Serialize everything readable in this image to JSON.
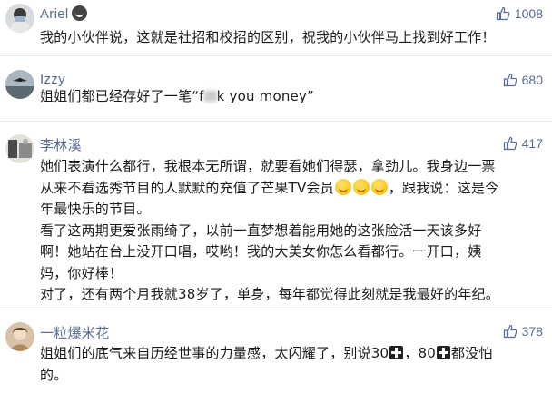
{
  "comments": [
    {
      "username": "Ariel",
      "likes": "1008",
      "lines": [
        "我的小伙伴说，这就是社招和校招的区别，祝我的小伙伴马上找到好工作！"
      ]
    },
    {
      "username": "Izzy",
      "likes": "680",
      "text_before": "姐姐们都已经存好了一笔“f",
      "text_after": "k you money”"
    },
    {
      "username": "李林溪",
      "likes": "417",
      "lines": [
        "她们表演什么都行，我根本无所谓，就要看她们得瑟，拿劲儿。我身边一票",
        "从来不看选秀节目的人默默的充值了芒果TV会员",
        "，跟我说：这是今",
        "年最快乐的节目。",
        "看了这两期更爱张雨绮了，以前一直梦想着能用她的这张脸活一天该多好",
        "啊！她站在台上没开口唱，哎哟！我的大美女你怎么看都行。一开口，姨",
        "妈，你好棒！",
        "对了，还有两个月我就38岁了，单身，每年都觉得此刻就是我最好的年纪。"
      ]
    },
    {
      "username": "一粒爆米花",
      "likes": "378",
      "lines": [
        "姐姐们的底气来自历经世事的力量感，太闪耀了，别说30",
        "，80",
        "都没怕",
        "的。"
      ]
    }
  ]
}
